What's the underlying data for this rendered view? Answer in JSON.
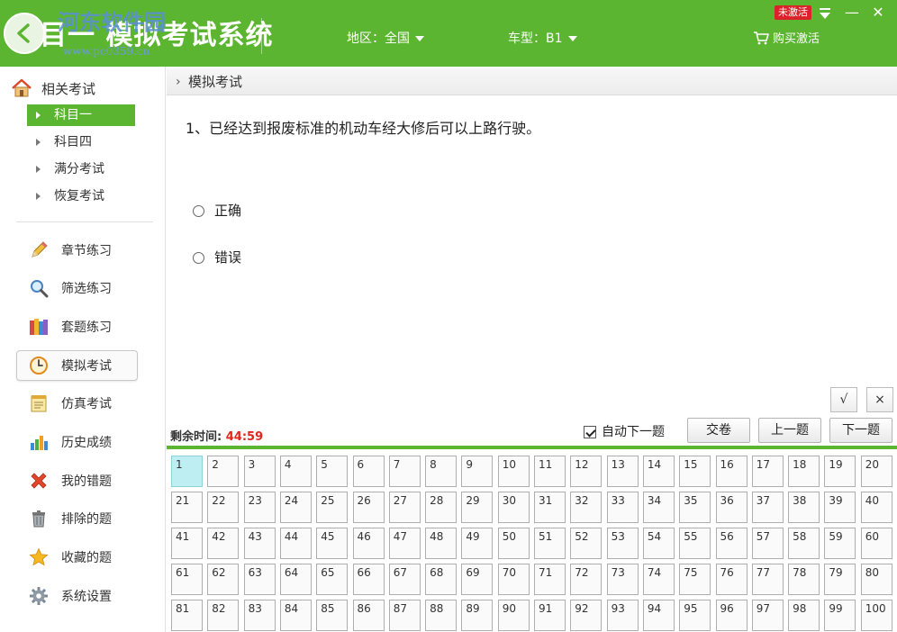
{
  "header": {
    "back_icon": "back-arrow-icon",
    "title": "目一  模拟考试系统",
    "watermark": "河东软件园",
    "watermark_url": "www.pc0359.cn",
    "region_label": "地区：全国",
    "car_type_label": "车型：B1",
    "buy_label": "购买激活",
    "badge": "未激活",
    "minimize": "—",
    "close": "✕"
  },
  "sidebar": {
    "heading": "相关考试",
    "sub_items": [
      {
        "label": "科目一",
        "active": true
      },
      {
        "label": "科目四",
        "active": false
      },
      {
        "label": "满分考试",
        "active": false
      },
      {
        "label": "恢复考试",
        "active": false
      }
    ],
    "nav_items": [
      {
        "label": "章节练习",
        "icon": "pencil-icon",
        "active": false
      },
      {
        "label": "筛选练习",
        "icon": "magnifier-icon",
        "active": false
      },
      {
        "label": "套题练习",
        "icon": "books-icon",
        "active": false
      },
      {
        "label": "模拟考试",
        "icon": "clock-icon",
        "active": true
      },
      {
        "label": "仿真考试",
        "icon": "notepad-icon",
        "active": false
      },
      {
        "label": "历史成绩",
        "icon": "bar-chart-icon",
        "active": false
      },
      {
        "label": "我的错题",
        "icon": "red-x-icon",
        "active": false
      },
      {
        "label": "排除的题",
        "icon": "trash-icon",
        "active": false
      },
      {
        "label": "收藏的题",
        "icon": "star-icon",
        "active": false
      },
      {
        "label": "系统设置",
        "icon": "gear-icon",
        "active": false
      }
    ]
  },
  "main": {
    "breadcrumb": "模拟考试",
    "question": "1、已经达到报废标准的机动车经大修后可以上路行驶。",
    "options": [
      "正确",
      "错误"
    ],
    "tick_right": "√",
    "tick_wrong": "×",
    "timer_label": "剩余时间:",
    "timer_value": "44:59",
    "auto_next_label": "自动下一题",
    "auto_next_checked": true,
    "submit_label": "交卷",
    "prev_label": "上一题",
    "next_label": "下一题",
    "current_question": 1,
    "question_count": 100
  },
  "colors": {
    "brand_green": "#5cb531",
    "timer_red": "#e1261c",
    "current_cell": "#bfeef2",
    "badge_red": "#d9222a"
  }
}
